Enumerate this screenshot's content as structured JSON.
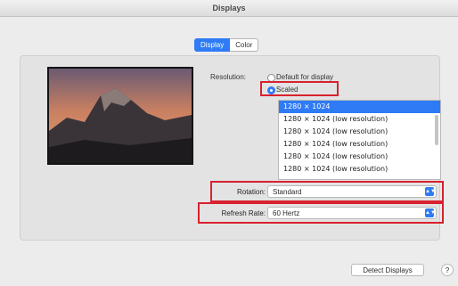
{
  "window": {
    "title": "Displays"
  },
  "tabs": [
    {
      "label": "Display",
      "active": true
    },
    {
      "label": "Color",
      "active": false
    }
  ],
  "resolution": {
    "label": "Resolution:",
    "options": [
      {
        "label": "Default for display",
        "selected": false
      },
      {
        "label": "Scaled",
        "selected": true
      }
    ],
    "list": [
      {
        "label": "1280 × 1024",
        "selected": true
      },
      {
        "label": "1280 × 1024 (low resolution)",
        "selected": false
      },
      {
        "label": "1280 × 1024 (low resolution)",
        "selected": false
      },
      {
        "label": "1280 × 1024 (low resolution)",
        "selected": false
      },
      {
        "label": "1280 × 1024 (low resolution)",
        "selected": false
      },
      {
        "label": "1280 × 1024 (low resolution)",
        "selected": false
      }
    ]
  },
  "rotation": {
    "label": "Rotation:",
    "value": "Standard"
  },
  "refresh_rate": {
    "label": "Refresh Rate:",
    "value": "60 Hertz"
  },
  "footer": {
    "detect_label": "Detect Displays",
    "help_label": "?"
  },
  "colors": {
    "accent": "#2f7bf5",
    "highlight": "#d8222f"
  }
}
